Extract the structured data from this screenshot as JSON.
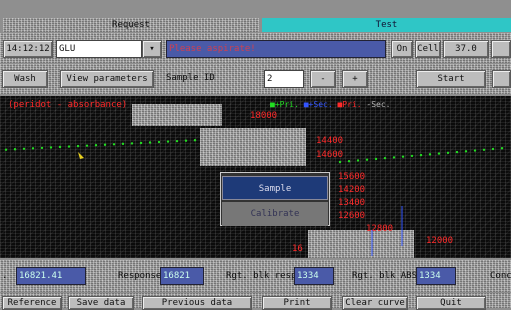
{
  "tabs": {
    "request": "Request",
    "test": "Test"
  },
  "top_bar": {
    "time": "14:12:12",
    "test_name": "GLU",
    "message": "Please aspirate!",
    "on_label": "On",
    "cell_label": "Cell",
    "temperature": "37.0"
  },
  "toolbar": {
    "wash": "Wash",
    "view_parameters": "View parameters",
    "sample_id_label": "Sample ID",
    "sample_id_value": "2",
    "minus": "-",
    "plus": "+",
    "start": "Start"
  },
  "plot": {
    "left_label": "(peridot - absorbance)",
    "legend": {
      "pri_plus": "Pri.",
      "sec_plus": "Sec.",
      "pri_minus": "Pri.",
      "sec_minus": "Sec."
    },
    "yticks": [
      "18000",
      "14400",
      "14600",
      "15600",
      "14200",
      "13400",
      "12600",
      "12800",
      "12000"
    ],
    "left_tick": "16",
    "colors": {
      "primary": "#22dd22",
      "secondary": "#3355ff",
      "primary_minus": "#ff2a2a",
      "marker": "#e8d020"
    }
  },
  "popup_menu": {
    "sample": "Sample",
    "calibrate": "Calibrate"
  },
  "status_bar": {
    "absorbance_value": "16821.41",
    "response_label": "Response",
    "response_value": "16821",
    "rgt_blk_resp_label": "Rgt. blk resp",
    "rgt_blk_resp_value": "1334",
    "rgt_blk_abs_label": "Rgt. blk ABS",
    "rgt_blk_abs_value": "1334",
    "conc_label": "Conc"
  },
  "bottom_buttons": [
    "Reference",
    "Save data",
    "Previous data",
    "Print",
    "Clear curve",
    "Quit"
  ]
}
